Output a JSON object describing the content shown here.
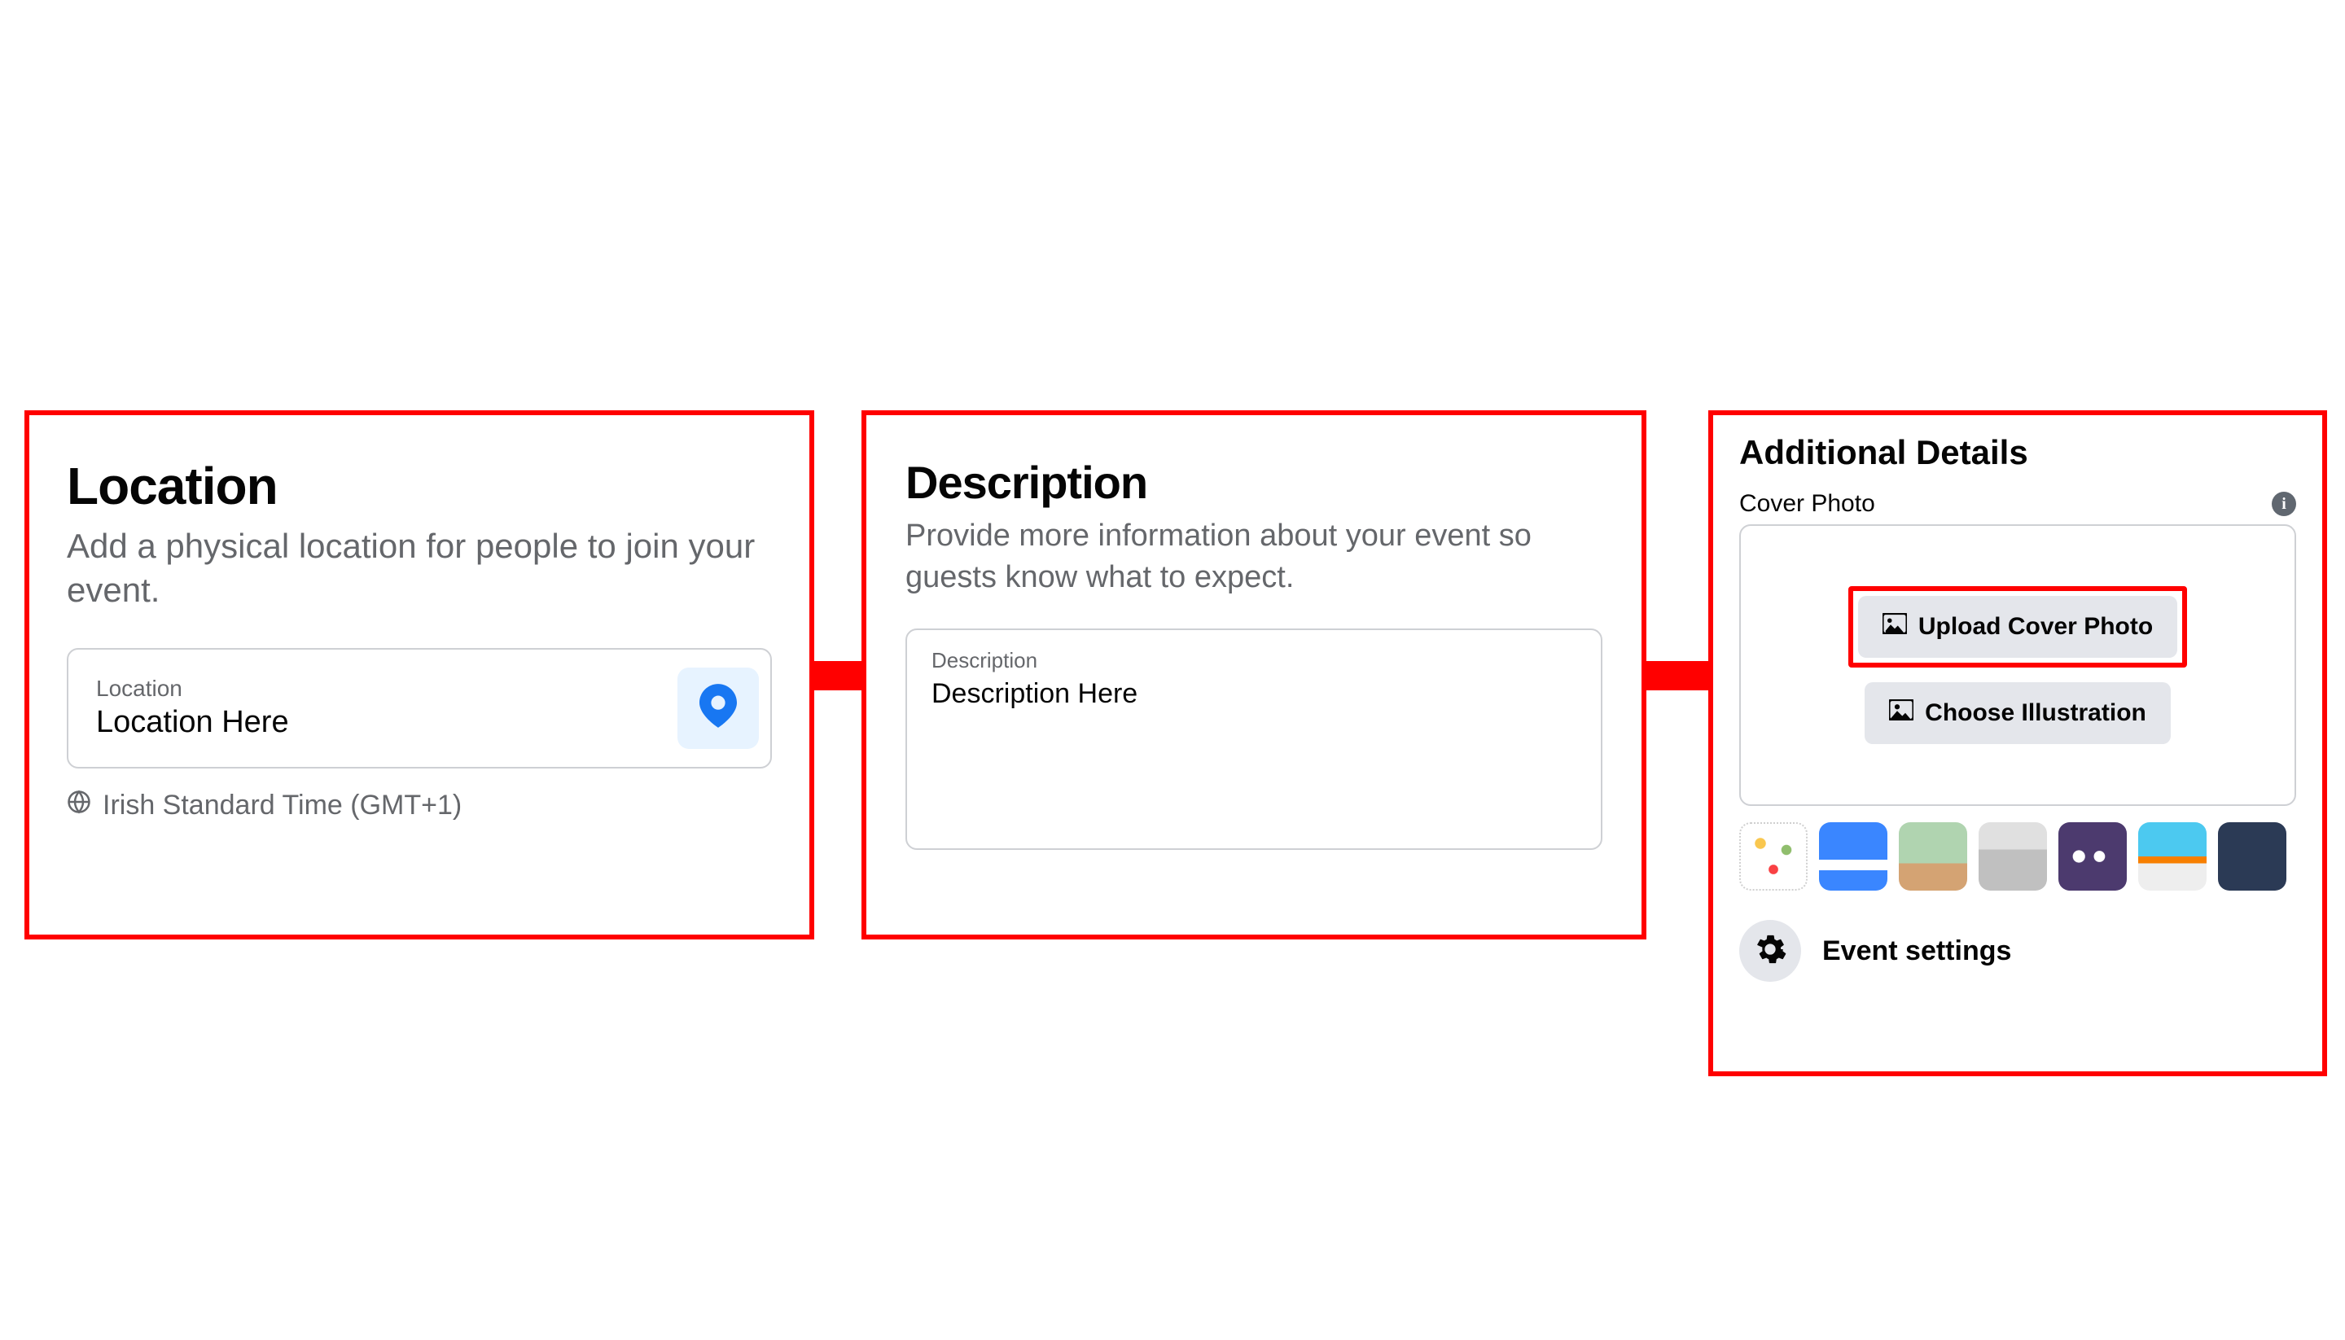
{
  "location": {
    "title": "Location",
    "subtitle": "Add a physical location for people to join your event.",
    "field_label": "Location",
    "field_value": "Location Here",
    "timezone": "Irish Standard Time (GMT+1)"
  },
  "description": {
    "title": "Description",
    "subtitle": "Provide more information about your event so guests know what to expect.",
    "field_label": "Description",
    "field_value": "Description Here"
  },
  "additional": {
    "title": "Additional Details",
    "cover_label": "Cover Photo",
    "upload_button": "Upload Cover Photo",
    "illustration_button": "Choose Illustration",
    "settings_label": "Event settings"
  }
}
